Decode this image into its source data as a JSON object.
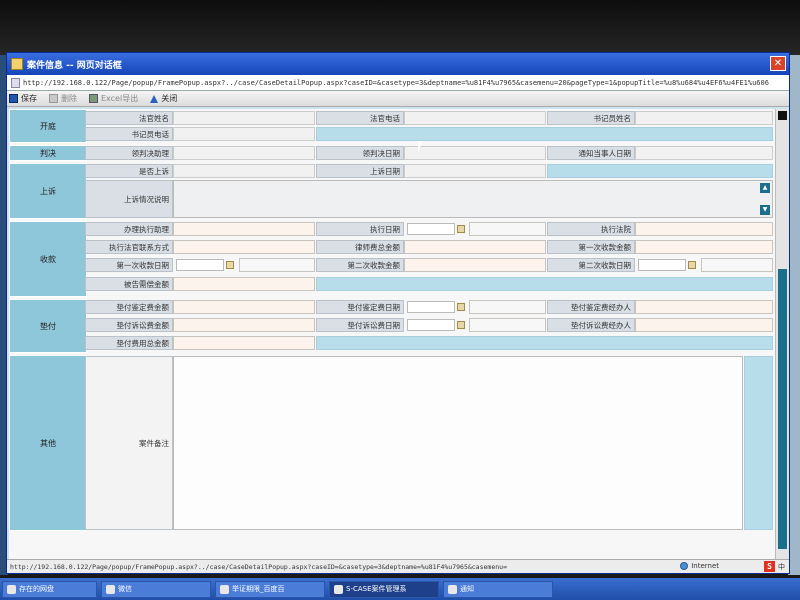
{
  "window": {
    "title": "案件信息 -- 网页对话框",
    "address": "http://192.168.0.122/Page/popup/FramePopup.aspx?../case/CaseDetailPopup.aspx?caseID=&casetype=3&deptname=%u81F4%u7965&casemenu=20&pageType=1&popupTitle=%u8%u684%u4EF6%u4FE1%u606",
    "close_glyph": "✕"
  },
  "toolbar": {
    "save": "保存",
    "delete": "删除",
    "excel": "Excel导出",
    "close": "关闭"
  },
  "sections": {
    "kaiting": "开庭",
    "panjue": "判决",
    "shangsu": "上诉",
    "shoukuan": "收款",
    "dianfu": "垫付",
    "qita": "其他"
  },
  "kaiting": {
    "judge_name": "法官姓名",
    "judge_phone": "法官电话",
    "clerk_name": "书记员姓名",
    "clerk_phone": "书记员电话"
  },
  "panjue": {
    "receive_judgment": "领判决助理",
    "receive_date": "领判决日期",
    "notify_date": "通知当事人日期"
  },
  "shangsu": {
    "is_appeal": "是否上诉",
    "appeal_date": "上诉日期",
    "appeal_desc": "上诉情况说明"
  },
  "shoukuan": {
    "exec_assistant": "办理执行助理",
    "exec_date": "执行日期",
    "exec_court": "执行法院",
    "exec_judge_contact": "执行法官联系方式",
    "lawyer_fee_total": "律师费总金额",
    "first_amount": "第一次收款金额",
    "first_date": "第一次收款日期",
    "second_amount": "第二次收款金额",
    "second_date": "第二次收款日期",
    "defendant_amount": "被告需偿金额"
  },
  "dianfu": {
    "appraisal_amount": "垫付鉴定费金额",
    "appraisal_date": "垫付鉴定费日期",
    "appraisal_handler": "垫付鉴定费经办人",
    "litigation_amount": "垫付诉讼费金额",
    "litigation_date": "垫付诉讼费日期",
    "litigation_handler": "垫付诉讼费经办人",
    "total_amount": "垫付费用总金额"
  },
  "qita": {
    "remarks": "案件备注"
  },
  "statusbar": {
    "url": "http://192.168.0.122/Page/popup/FramePopup.aspx?../case/CaseDetailPopup.aspx?caseID=&casetype=3&deptname=%u81F4%u7965&casemenu=",
    "zone": "Internet",
    "ime": "中"
  },
  "taskbar": {
    "items": [
      "存在的网盘",
      "微信",
      "举证期限_百度百",
      "S-CASE案件管理系",
      "通知"
    ]
  }
}
